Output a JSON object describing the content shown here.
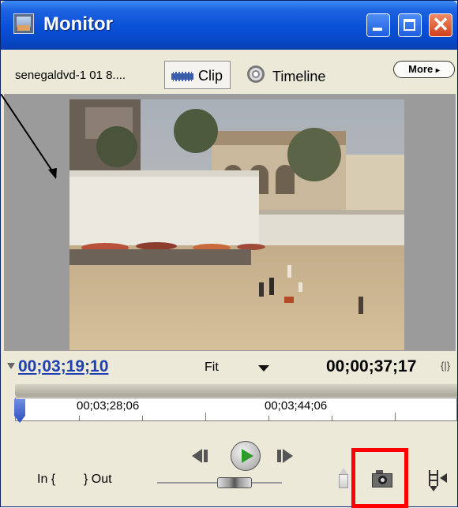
{
  "window": {
    "title": "Monitor",
    "icon": "monitor-app-icon",
    "close_glyph": "✕"
  },
  "toolbar": {
    "clip_name": "senegaldvd-1 01 8....",
    "clip_tab_label": "Clip",
    "timeline_tab_label": "Timeline",
    "more_label": "More",
    "more_arrow": "▸"
  },
  "timecode": {
    "current": "00;03;19;10",
    "zoom_label": "Fit",
    "duration": "00;00;37;17",
    "duration_icon": "{|}"
  },
  "ruler": {
    "labels": [
      "00;03;28;06",
      "00;03;44;06"
    ]
  },
  "controls": {
    "in_label": "In {",
    "out_label": "} Out",
    "jog_level": 0.62
  },
  "colors": {
    "titlebar": "#0a50d8",
    "current_timecode": "#1f3fb0",
    "play": "#2e9a2a",
    "highlight": "#ff0000"
  }
}
